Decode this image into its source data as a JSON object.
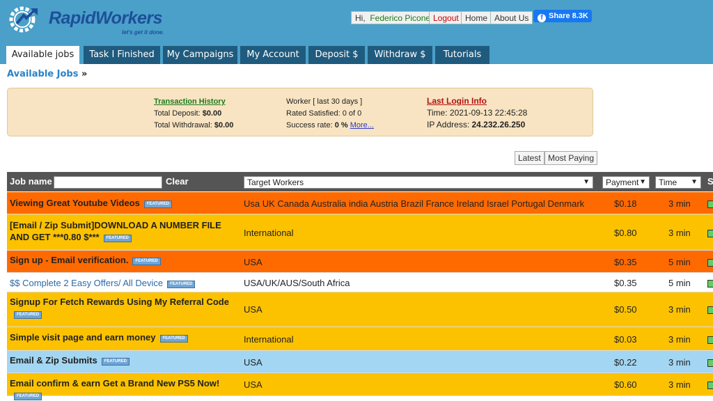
{
  "brand": {
    "name": "RapidWorkers",
    "tagline": "let's get it done."
  },
  "header": {
    "greeting": "Hi,",
    "user": "Federico Picone",
    "logout": "Logout",
    "home": "Home",
    "about": "About Us",
    "share": "Share 8.3K"
  },
  "tabs": [
    "Available jobs",
    "Task I Finished",
    "My Campaigns",
    "My Account",
    "Deposit $",
    "Withdraw $",
    "Tutorials"
  ],
  "breadcrumb": {
    "label": "Available Jobs",
    "arrow": "»"
  },
  "info": {
    "transaction_title": "Transaction History",
    "total_deposit_label": "Total Deposit:",
    "total_deposit": "$0.00",
    "total_withdrawal_label": "Total Withdrawal:",
    "total_withdrawal": "$0.00",
    "worker_label": "Worker [ last 30 days ]",
    "rated": "Rated Satisfied: 0 of 0",
    "success_label": "Success rate:",
    "success_value": "0 %",
    "more": "More...",
    "login_title": "Last Login Info",
    "time": "Time: 2021-09-13 22:45:28",
    "ip_label": "IP Address:",
    "ip": "24.232.26.250"
  },
  "sort": {
    "latest": "Latest",
    "most_paying": "Most Paying"
  },
  "table": {
    "job_name": "Job name",
    "clear": "Clear",
    "target": "Target Workers",
    "payment": "Payment",
    "time": "Time",
    "status_head": "S"
  },
  "featured_label": "FEATURED",
  "colors": {
    "header": "#4aa0c8",
    "tab": "#1f5b7e",
    "orange": "#ff6a00",
    "yellow": "#fcc200",
    "blue": "#a3d6f2"
  },
  "jobs": [
    {
      "name": "Viewing Great Youtube Videos",
      "target": "Usa UK Canada Australia india Austria Brazil France Ireland Israel Portugal Denmark",
      "payment": "$0.18",
      "time": "3 min",
      "color": "orange"
    },
    {
      "name": "[Email / Zip Submit]DOWNLOAD A NUMBER FILE AND GET ***0.80 $***",
      "target": "International",
      "payment": "$0.80",
      "time": "3 min",
      "color": "yellow"
    },
    {
      "name": "Sign up - Email verification.",
      "target": "USA",
      "payment": "$0.35",
      "time": "5 min",
      "color": "orange"
    },
    {
      "name": "$$ Complete 2 Easy Offers/ All Device",
      "target": "USA/UK/AUS/South Africa",
      "payment": "$0.35",
      "time": "5 min",
      "color": "white"
    },
    {
      "name": "Signup For Fetch Rewards Using My Referral Code",
      "target": "USA",
      "payment": "$0.50",
      "time": "3 min",
      "color": "yellow"
    },
    {
      "name": "Simple visit page and earn money",
      "target": "International",
      "payment": "$0.03",
      "time": "3 min",
      "color": "yellow"
    },
    {
      "name": "Email & Zip Submits",
      "target": "USA",
      "payment": "$0.22",
      "time": "3 min",
      "color": "blue"
    },
    {
      "name": "Email confirm & earn Get a Brand New PS5 Now!",
      "target": "USA",
      "payment": "$0.60",
      "time": "3 min",
      "color": "yellow"
    }
  ]
}
